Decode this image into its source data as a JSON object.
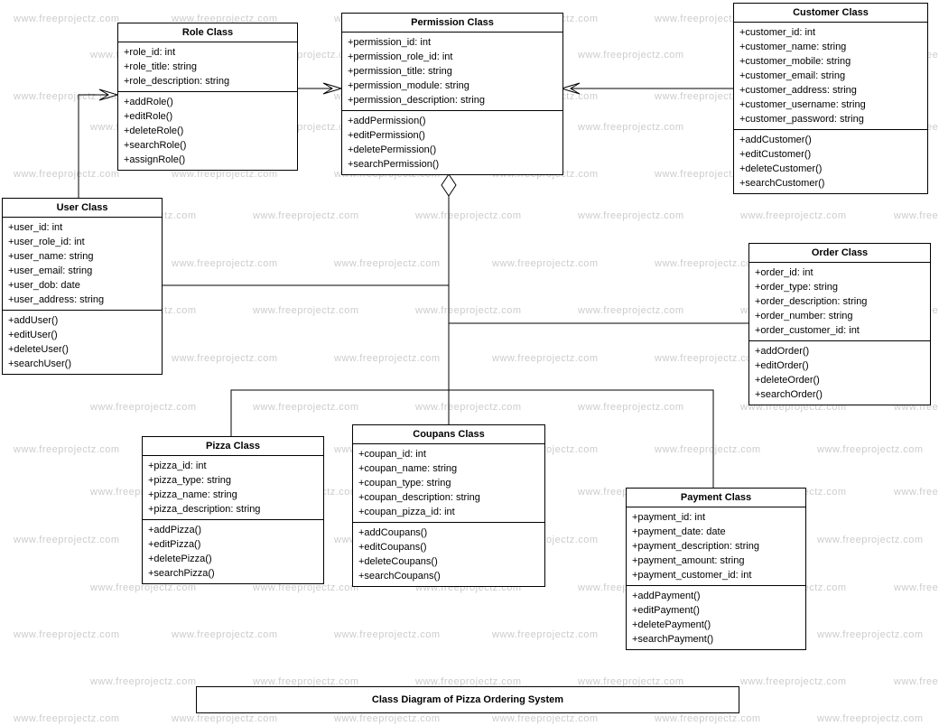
{
  "title": "Class Diagram of Pizza Ordering System",
  "watermark": "www.freeprojectz.com",
  "classes": {
    "role": {
      "name": "Role Class",
      "attrs": [
        "+role_id: int",
        "+role_title: string",
        "+role_description: string"
      ],
      "ops": [
        "+addRole()",
        "+editRole()",
        "+deleteRole()",
        "+searchRole()",
        "+assignRole()"
      ]
    },
    "permission": {
      "name": "Permission Class",
      "attrs": [
        "+permission_id: int",
        "+permission_role_id: int",
        "+permission_title: string",
        "+permission_module: string",
        "+permission_description: string"
      ],
      "ops": [
        "+addPermission()",
        "+editPermission()",
        "+deletePermission()",
        "+searchPermission()"
      ]
    },
    "customer": {
      "name": "Customer Class",
      "attrs": [
        "+customer_id: int",
        "+customer_name: string",
        "+customer_mobile: string",
        "+customer_email: string",
        "+customer_address: string",
        "+customer_username: string",
        "+customer_password: string"
      ],
      "ops": [
        "+addCustomer()",
        "+editCustomer()",
        "+deleteCustomer()",
        "+searchCustomer()"
      ]
    },
    "user": {
      "name": "User Class",
      "attrs": [
        "+user_id: int",
        "+user_role_id: int",
        "+user_name: string",
        "+user_email: string",
        "+user_dob: date",
        "+user_address: string"
      ],
      "ops": [
        "+addUser()",
        "+editUser()",
        "+deleteUser()",
        "+searchUser()"
      ]
    },
    "order": {
      "name": "Order Class",
      "attrs": [
        "+order_id: int",
        "+order_type: string",
        "+order_description: string",
        "+order_number: string",
        "+order_customer_id: int"
      ],
      "ops": [
        "+addOrder()",
        "+editOrder()",
        "+deleteOrder()",
        "+searchOrder()"
      ]
    },
    "pizza": {
      "name": "Pizza Class",
      "attrs": [
        "+pizza_id: int",
        "+pizza_type: string",
        "+pizza_name: string",
        "+pizza_description: string"
      ],
      "ops": [
        "+addPizza()",
        "+editPizza()",
        "+deletePizza()",
        "+searchPizza()"
      ]
    },
    "coupans": {
      "name": "Coupans  Class",
      "attrs": [
        "+coupan_id: int",
        "+coupan_name: string",
        "+coupan_type: string",
        "+coupan_description: string",
        "+coupan_pizza_id: int"
      ],
      "ops": [
        "+addCoupans()",
        "+editCoupans()",
        "+deleteCoupans()",
        "+searchCoupans()"
      ]
    },
    "payment": {
      "name": "Payment Class",
      "attrs": [
        "+payment_id: int",
        "+payment_date: date",
        "+payment_description: string",
        "+payment_amount: string",
        "+payment_customer_id: int"
      ],
      "ops": [
        "+addPayment()",
        "+editPayment()",
        "+deletePayment()",
        "+searchPayment()"
      ]
    }
  }
}
